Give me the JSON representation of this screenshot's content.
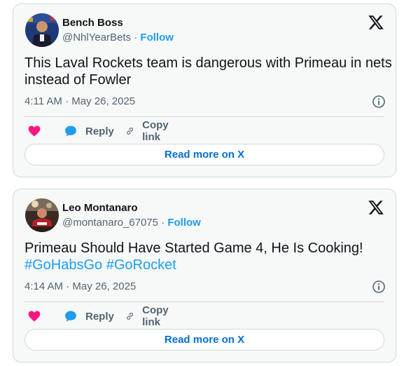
{
  "tweets": [
    {
      "author_name": "Bench Boss",
      "handle": "@NhlYearBets",
      "separator": "·",
      "follow_label": "Follow",
      "text_lines": [
        "This Laval Rockets team is dangerous with Primeau in nets",
        "instead of Fowler"
      ],
      "timestamp": "4:11 AM · May 26, 2025",
      "reply_label": "Reply",
      "copy_link_label": "Copy link",
      "read_more_label": "Read more on X"
    },
    {
      "author_name": "Leo Montanaro",
      "handle": "@montanaro_67075",
      "separator": "·",
      "follow_label": "Follow",
      "text_line1": "Primeau Should Have Started Game 4, He Is Cooking!",
      "hashtags": [
        "#GoHabsGo",
        "#GoRocket"
      ],
      "timestamp": "4:14 AM · May 26, 2025",
      "reply_label": "Reply",
      "copy_link_label": "Copy link",
      "read_more_label": "Read more on X"
    }
  ],
  "colors": {
    "accent": "#1d9bf0",
    "read_more": "#006fd6",
    "heart": "#f91880",
    "secondary_text": "#536471",
    "card_background": "#f7f9f9",
    "border": "#cfd9de"
  },
  "icons": {
    "logo": "x-logo-icon",
    "info": "info-icon",
    "like": "heart-icon",
    "reply": "speech-bubble-icon",
    "copy_link": "link-icon"
  }
}
